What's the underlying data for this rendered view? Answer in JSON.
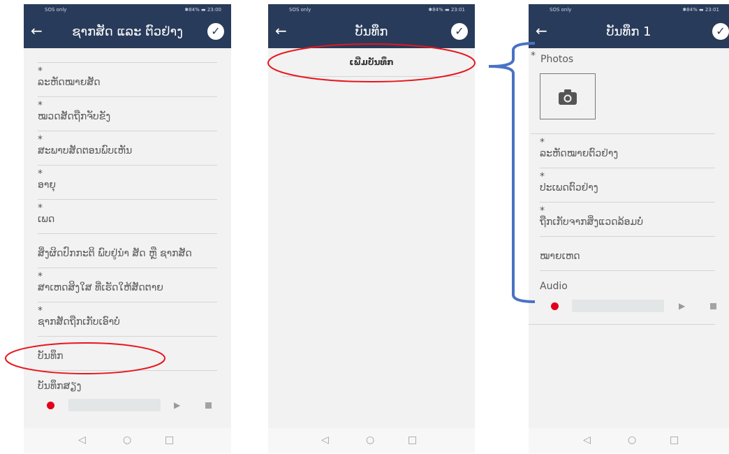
{
  "screen1": {
    "status_left": "SOS only",
    "status_right": "✱84% ▬ 23:00",
    "title": "ຊາກສັດ ແລະ ຕົວຢ່າງ",
    "fields": [
      {
        "label": "ລະຫັດໝາຍສັດ",
        "required": "*"
      },
      {
        "label": "ໝວດສັດຖືກຈັບຂັງ",
        "required": "*"
      },
      {
        "label": "ສະພາບສັດຕອນພົບເຫັນ",
        "required": "*"
      },
      {
        "label": "ອາຍຸ",
        "required": "*"
      },
      {
        "label": "ເພດ",
        "required": "*"
      },
      {
        "label": "ສິ່ງຜິດປົກກະຕິ ພົບຢູ່ນຳ ສັດ ຫຼື ຊາກສັດ",
        "required": ""
      },
      {
        "label": "ສາເຫດສິງໃສ ທີ່ເຮັດໃຫ້ສັດຕາຍ",
        "required": "*"
      },
      {
        "label": "ຊາກສັດຖືກເກັບເອົາບໍ່",
        "required": "*"
      },
      {
        "label": "ບັນທຶກ",
        "required": ""
      }
    ],
    "audio_label": "ບັນທຶກສຽງ"
  },
  "screen2": {
    "status_left": "SOS only",
    "status_right": "✱84% ▬ 23:01",
    "title": "ບັນທຶກ",
    "add_button": "ເພີ່ມບັນທຶກ"
  },
  "screen3": {
    "status_left": "SOS only",
    "status_right": "✱84% ▬ 23:01",
    "title": "ບັນທຶກ 1",
    "photos_label": "Photos",
    "fields": [
      {
        "label": "ລະຫັດໝາຍຕົວຢ່າງ",
        "required": "*"
      },
      {
        "label": "ປະເພດຕົວຢ່າງ",
        "required": "*"
      },
      {
        "label": "ຖືກເກັບຈາກສິ່ງແວດລ້ອມບໍ່",
        "required": "*"
      },
      {
        "label": "ໝາຍເຫດ",
        "required": ""
      }
    ],
    "audio_label": "Audio"
  },
  "icons": {
    "back": "arrow-left-icon",
    "check": "check-circle-icon",
    "camera": "camera-icon",
    "record": "record-icon",
    "play": "play-icon",
    "stop": "stop-icon"
  },
  "colors": {
    "appbar": "#293b5a",
    "annotation_red": "#e8161e",
    "annotation_blue": "#4a72c4",
    "record_red": "#e2001a"
  }
}
